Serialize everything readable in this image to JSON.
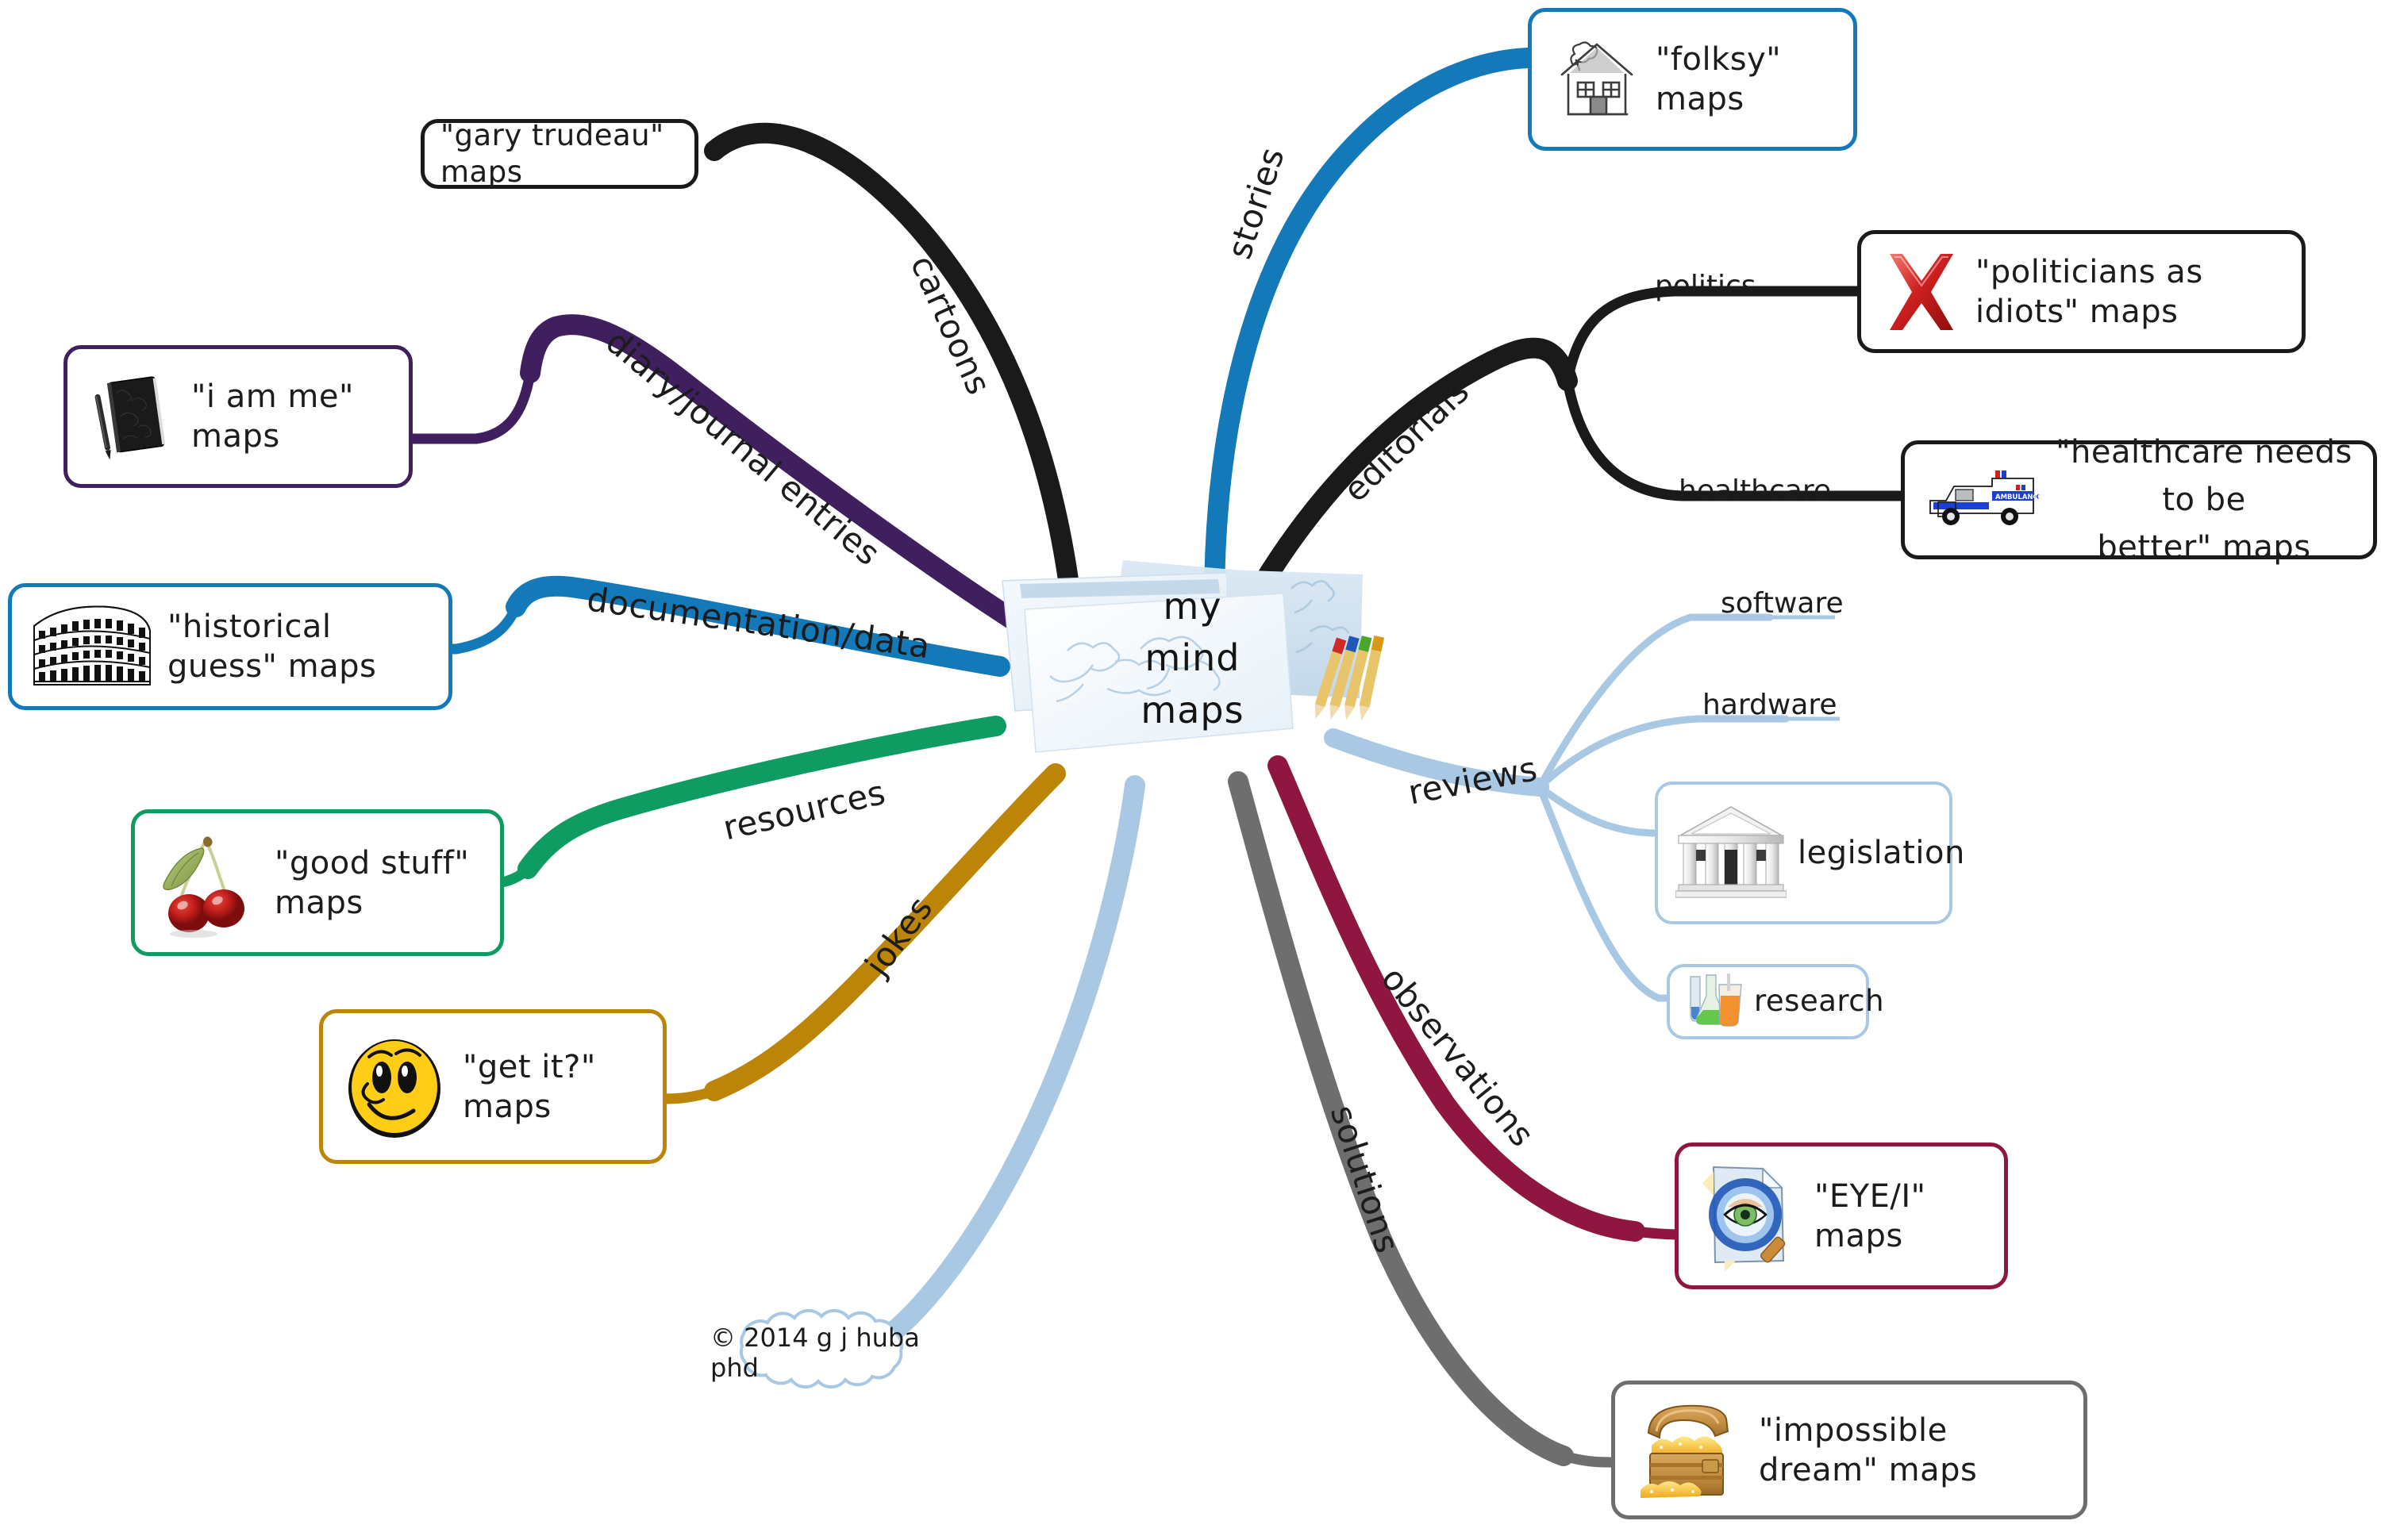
{
  "center": {
    "line1": "my",
    "line2": "mind",
    "line3": "maps",
    "icon": "stack-of-mindmap-papers-with-colored-pencils"
  },
  "colors": {
    "cartoons": "#1a1a1a",
    "diary": "#3f1f5e",
    "documentation": "#1479b8",
    "resources": "#0f9c63",
    "jokes": "#bd8508",
    "copyright": "#a8c8e4",
    "solutions": "#6e6e6e",
    "observations": "#8f1641",
    "reviews": "#a8c8e4",
    "editorials": "#1a1a1a",
    "stories": "#1479b8"
  },
  "branches": [
    {
      "id": "cartoons",
      "label": "cartoons",
      "color": "#1a1a1a",
      "children": [
        {
          "id": "gary-trudeau",
          "label": "\"gary trudeau\" maps",
          "border": "#1a1a1a",
          "icon": "none"
        }
      ]
    },
    {
      "id": "diary",
      "label": "diary/journal entries",
      "color": "#3f1f5e",
      "children": [
        {
          "id": "i-am-me",
          "label": "\"i am me\" maps",
          "border": "#3f1f5e",
          "icon": "black-notebook-and-pen-icon"
        }
      ]
    },
    {
      "id": "documentation",
      "label": "documentation/data",
      "color": "#1479b8",
      "children": [
        {
          "id": "historical-guess",
          "label": "\"historical guess\" maps",
          "border": "#1479b8",
          "icon": "colosseum-icon"
        }
      ]
    },
    {
      "id": "resources",
      "label": "resources",
      "color": "#0f9c63",
      "children": [
        {
          "id": "good-stuff",
          "label": "\"good stuff\" maps",
          "border": "#0f9c63",
          "icon": "cherries-icon"
        }
      ]
    },
    {
      "id": "jokes",
      "label": "jokes",
      "color": "#bd8508",
      "children": [
        {
          "id": "get-it",
          "label": "\"get it?\" maps",
          "border": "#bd8508",
          "icon": "smiley-face-icon"
        }
      ]
    },
    {
      "id": "copyright-branch",
      "label": "",
      "color": "#a8c8e4",
      "children": [
        {
          "id": "copyright",
          "label": "© 2014 g j huba phd",
          "border": "#a8c8e4",
          "icon": "none",
          "shape": "cloud"
        }
      ]
    },
    {
      "id": "solutions",
      "label": "solutions",
      "color": "#6e6e6e",
      "children": [
        {
          "id": "impossible-dream",
          "label": "\"impossible dream\" maps",
          "border": "#6e6e6e",
          "icon": "treasure-chest-icon"
        }
      ]
    },
    {
      "id": "observations",
      "label": "observations",
      "color": "#8f1641",
      "children": [
        {
          "id": "eye-i",
          "label": "\"EYE/I\" maps",
          "border": "#8f1641",
          "icon": "eye-magnifier-document-icon"
        }
      ]
    },
    {
      "id": "reviews",
      "label": "reviews",
      "color": "#a8c8e4",
      "children": [
        {
          "id": "software",
          "label": "software",
          "border": "none",
          "icon": "none"
        },
        {
          "id": "hardware",
          "label": "hardware",
          "border": "none",
          "icon": "none"
        },
        {
          "id": "legislation",
          "label": "legislation",
          "border": "#a8c8e4",
          "icon": "bank-building-icon"
        },
        {
          "id": "research",
          "label": "research",
          "border": "#a8c8e4",
          "icon": "beakers-flasks-icon"
        }
      ]
    },
    {
      "id": "editorials",
      "label": "editorials",
      "color": "#1a1a1a",
      "children": [
        {
          "id": "politics",
          "label": "politics",
          "border": "none",
          "icon": "none",
          "children": [
            {
              "id": "politicians-as-idiots",
              "label": "\"politicians as idiots\" maps",
              "border": "#1a1a1a",
              "icon": "red-x-cross-icon"
            }
          ]
        },
        {
          "id": "healthcare",
          "label": "healthcare",
          "border": "none",
          "icon": "none",
          "children": [
            {
              "id": "healthcare-needs-better",
              "label": "\"healthcare needs to be\nbetter\" maps",
              "border": "#1a1a1a",
              "icon": "ambulance-icon"
            }
          ]
        }
      ]
    },
    {
      "id": "stories",
      "label": "stories",
      "color": "#1479b8",
      "children": [
        {
          "id": "folksy",
          "label": "\"folksy\" maps",
          "border": "#1479b8",
          "icon": "sketched-house-icon"
        }
      ]
    }
  ],
  "nodes": {
    "folksy": "\"folksy\" maps",
    "gary_trudeau": "\"gary trudeau\" maps",
    "politicians": "\"politicians as idiots\" maps",
    "i_am_me": "\"i am me\" maps",
    "healthcare_better": "\"healthcare needs to be\nbetter\" maps",
    "historical_guess": "\"historical guess\" maps",
    "good_stuff": "\"good stuff\" maps",
    "software": "software",
    "hardware": "hardware",
    "legislation": "legislation",
    "research": "research",
    "get_it": "\"get it?\" maps",
    "eye_i": "\"EYE/I\" maps",
    "copyright": "© 2014 g j huba phd",
    "impossible_dream": "\"impossible dream\" maps",
    "politics": "politics",
    "healthcare": "healthcare"
  },
  "branch_labels": {
    "cartoons": "cartoons",
    "diary": "diary/journal entries",
    "documentation": "documentation/data",
    "resources": "resources",
    "jokes": "jokes",
    "solutions": "solutions",
    "observations": "observations",
    "reviews": "reviews",
    "editorials": "editorials",
    "stories": "stories"
  }
}
